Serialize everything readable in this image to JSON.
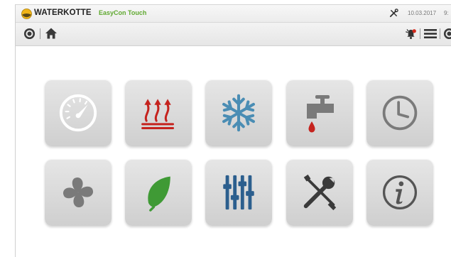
{
  "header": {
    "brand": "WATERKOTTE",
    "product": "EasyCon Touch",
    "date": "10.03.2017",
    "time": "9:",
    "logo_icon": "waterkotte-logo-icon",
    "tools_icon": "tools-icon"
  },
  "navbar": {
    "left": [
      "target-icon",
      "home-icon"
    ],
    "right": [
      "alarm-bell-icon",
      "menu-icon",
      "target-icon"
    ]
  },
  "tiles": [
    {
      "icon": "gauge-icon",
      "color": "#ffffff"
    },
    {
      "icon": "heating-icon",
      "color": "#c5231e"
    },
    {
      "icon": "snowflake-icon",
      "color": "#4a8db4"
    },
    {
      "icon": "water-tap-icon",
      "color": "#7a7a7a"
    },
    {
      "icon": "clock-icon",
      "color": "#7a7a7a"
    },
    {
      "icon": "fan-icon",
      "color": "#7a7a7a"
    },
    {
      "icon": "leaf-icon",
      "color": "#3f9a35"
    },
    {
      "icon": "sliders-icon",
      "color": "#2c5f8e"
    },
    {
      "icon": "tools-icon",
      "color": "#3a3a3a"
    },
    {
      "icon": "info-icon",
      "color": "#555555"
    }
  ],
  "colors": {
    "accent_green": "#5fa82f",
    "logo_yellow": "#f0b419",
    "tile_bg": "#d8d8d8"
  }
}
